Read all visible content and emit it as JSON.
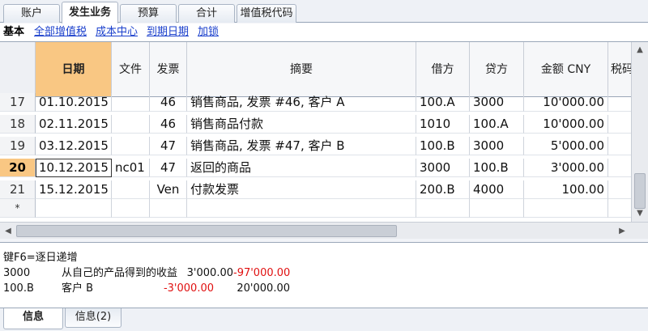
{
  "top_tabs": [
    "账户",
    "发生业务",
    "预算",
    "合计",
    "增值税代码"
  ],
  "views": {
    "current": "基本",
    "links": [
      "全部增值税",
      "成本中心",
      "到期日期",
      "加锁"
    ]
  },
  "columns": [
    "",
    "日期",
    "文件",
    "发票",
    "摘要",
    "借方",
    "贷方",
    "金额 CNY",
    "税码"
  ],
  "rows": [
    {
      "n": "17",
      "date": "01.10.2015",
      "doc": "",
      "inv": "46",
      "desc": "销售商品, 发票 #46, 客户 A",
      "debit": "100.A",
      "credit": "3000",
      "amount": "10'000.00"
    },
    {
      "n": "18",
      "date": "02.11.2015",
      "doc": "",
      "inv": "46",
      "desc": "销售商品付款",
      "debit": "1010",
      "credit": "100.A",
      "amount": "10'000.00"
    },
    {
      "n": "19",
      "date": "03.12.2015",
      "doc": "",
      "inv": "47",
      "desc": "销售商品, 发票 #47, 客户 B",
      "debit": "100.B",
      "credit": "3000",
      "amount": "5'000.00"
    },
    {
      "n": "20",
      "date": "10.12.2015",
      "doc": "nc01",
      "inv": "47",
      "desc": "返回的商品",
      "debit": "3000",
      "credit": "100.B",
      "amount": "3'000.00"
    },
    {
      "n": "21",
      "date": "15.12.2015",
      "doc": "",
      "inv": "Ven",
      "desc": "付款发票",
      "debit": "200.B",
      "credit": "4000",
      "amount": "100.00"
    },
    {
      "n": "*",
      "date": "",
      "doc": "",
      "inv": "",
      "desc": "",
      "debit": "",
      "credit": "",
      "amount": ""
    }
  ],
  "info": {
    "hint": "键F6=逐日递增",
    "lines": [
      {
        "account": "3000",
        "desc": "从自己的产品得到的收益",
        "amount": "3'000.00",
        "balance": "-97'000.00"
      },
      {
        "account": "100.B",
        "desc": "客户 B",
        "amount": "-3'000.00",
        "balance": "20'000.00"
      }
    ]
  },
  "bottom_tabs": [
    "信息",
    "信息(2)"
  ],
  "colors": {
    "selected": "#f9c783",
    "negative": "#e01010",
    "link": "#1a3fcc"
  }
}
